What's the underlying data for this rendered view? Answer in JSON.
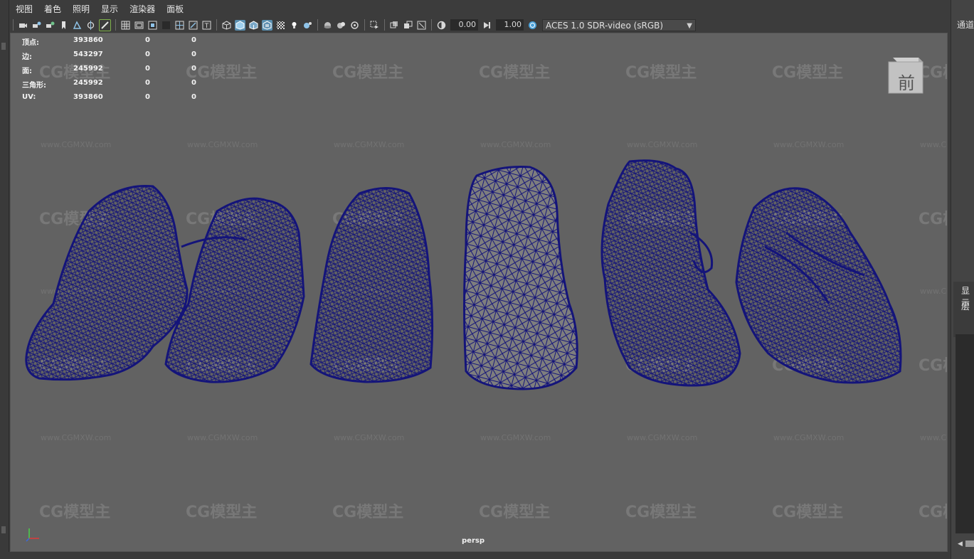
{
  "menu": [
    "视图",
    "着色",
    "照明",
    "显示",
    "渲染器",
    "面板"
  ],
  "toolbar": {
    "exposure": "0.00",
    "gamma": "1.00",
    "color_space": "ACES 1.0 SDR-video (sRGB)",
    "icons": [
      "camera-icon",
      "camera-attr-icon",
      "bookmark-cam-icon",
      "bookmark-icon",
      "image-plane-icon",
      "grid-snap-icon",
      "pencil-icon",
      "grid-icon",
      "film-gate-icon",
      "resolution-gate-icon",
      "gate-mask-icon",
      "field-chart-icon",
      "safe-action-icon",
      "safe-title-icon",
      "wireframe-icon",
      "smooth-shade-icon",
      "wireframe-on-shaded-icon",
      "textured-icon",
      "lighting-icon",
      "shadows-icon",
      "ambient-occlusion-icon",
      "motion-blur-icon",
      "anti-alias-icon",
      "depth-of-field-icon",
      "isolate-select-icon",
      "xray-icon",
      "xray-joints-icon",
      "backface-icon",
      "exposure-icon",
      "gamma-icon",
      "color-mgmt-icon"
    ]
  },
  "hud": {
    "rows": [
      {
        "label": "顶点:",
        "v1": "393860",
        "v2": "0",
        "v3": "0"
      },
      {
        "label": "边:",
        "v1": "543297",
        "v2": "0",
        "v3": "0"
      },
      {
        "label": "面:",
        "v1": "245992",
        "v2": "0",
        "v3": "0"
      },
      {
        "label": "三角形:",
        "v1": "245992",
        "v2": "0",
        "v3": "0"
      },
      {
        "label": "UV:",
        "v1": "393860",
        "v2": "0",
        "v3": "0"
      }
    ]
  },
  "viewport": {
    "camera": "persp",
    "view_cube": "前",
    "watermark_logo": "CG模型主",
    "watermark_url": "www.CGMXW.com",
    "wire_color": "#14147a",
    "bg_color": "#626262"
  },
  "right_panel": {
    "channel_label": "通道",
    "display_label": "显示",
    "layer_label": "层"
  }
}
